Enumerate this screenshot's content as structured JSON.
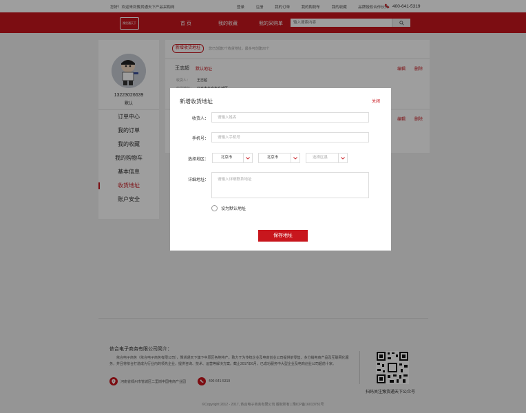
{
  "topbar": {
    "welcome": "您好！欢迎来到豫货通天下产品采购网",
    "links": [
      "登录",
      "注册",
      "我的订单",
      "我的购物车",
      "我的收藏",
      "品牌授权合作伙伴"
    ],
    "phone": "400-641-5319"
  },
  "nav": {
    "logo_text": "豫货通天下",
    "items": [
      "首 页",
      "我的收藏",
      "我的采购单"
    ],
    "search_placeholder": "输入搜索内容"
  },
  "sidebar": {
    "phone": "13223026639",
    "level": "默认",
    "menu": [
      "订单中心",
      "我的订单",
      "我的收藏",
      "我的购物车",
      "基本信息",
      "收货地址",
      "账户安全"
    ],
    "active_index": 5
  },
  "main": {
    "add_button": "新增收货地址",
    "tip": "您已创建0个收货地址，最多可创建20个",
    "addresses": [
      {
        "name": "王志超",
        "default_label": "默认地址",
        "edit": "编辑",
        "delete": "删除",
        "receiver_label": "收货人：",
        "receiver": "王志超",
        "address_label": "收货地址：",
        "address": "北京市北京市东城区"
      },
      {
        "edit": "编辑",
        "delete": "删除"
      }
    ]
  },
  "modal": {
    "title": "新增收货地址",
    "close": "关闭",
    "receiver_label": "收货人：",
    "receiver_placeholder": "请输入姓名",
    "phone_label": "手机号：",
    "phone_placeholder": "请输入手机号",
    "region_label": "选择地区：",
    "province": "北京市",
    "city": "北京市",
    "district": "选择区县",
    "detail_label": "详细地址：",
    "detail_placeholder": "请输入详细联系地址",
    "set_default": "设为默认地址",
    "save": "保存地址"
  },
  "footer": {
    "title": "依合电子商务有限公司简介：",
    "description": "依合电子商务（依合电子商务有限公司），豫货通天下旗下中原区各地特产。致力于为传统企业及电商创业公司提供前零售、多分销电商产品及互联网化服务，并且将依合打造成为行业内的领先企业，提供咨询、技术、运营等解决方案。截止2017年6月，已成功服务中大型企业及电商创业公司超前十家。",
    "address": "河南省郑州市管城区二里岗中国电商产业园",
    "tel": "400-641-5319",
    "qr_caption": "扫码关注豫货通天下公众号",
    "copyright": "©Copyright 2012 - 2017, 依合电子商务有限公司 版权所有 | 豫ICP备16013781号"
  },
  "colors": {
    "brand_red": "#c8161d",
    "page_bg": "#f0f0f0"
  },
  "icons": [
    "phone-icon",
    "search-icon",
    "location-icon",
    "chevron-down-icon",
    "qr-code"
  ]
}
